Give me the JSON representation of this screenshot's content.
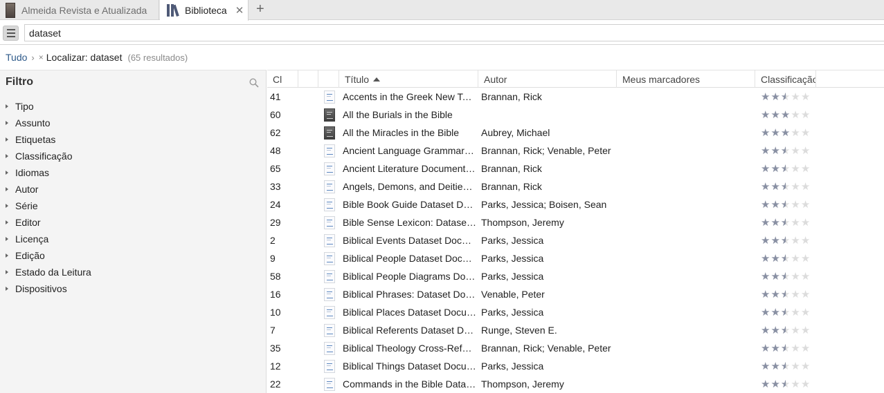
{
  "tabs": [
    {
      "label": "Almeida Revista e Atualizada",
      "active": false
    },
    {
      "label": "Biblioteca",
      "active": true
    }
  ],
  "search": {
    "value": "dataset"
  },
  "breadcrumb": {
    "root": "Tudo",
    "separator": "›",
    "remove": "×",
    "query": "Localizar: dataset",
    "count": "(65 resultados)"
  },
  "filter": {
    "title": "Filtro",
    "items": [
      "Tipo",
      "Assunto",
      "Etiquetas",
      "Classificação",
      "Idiomas",
      "Autor",
      "Série",
      "Editor",
      "Licença",
      "Edição",
      "Estado da Leitura",
      "Dispositivos"
    ]
  },
  "columns": {
    "num": "Cl",
    "title": "Título",
    "author": "Autor",
    "tags": "Meus marcadores",
    "rating": "Classificação"
  },
  "colors": {
    "accent_link": "#2e5a8a",
    "star_filled": "#8990a3",
    "star_empty": "#dcdcdc"
  },
  "rows": [
    {
      "num": "41",
      "title": "Accents in the Greek New Testament",
      "author": "Brannan, Rick",
      "icon": "document-icon",
      "rating": 2.5
    },
    {
      "num": "60",
      "title": "All the Burials in the Bible",
      "author": "",
      "icon": "dark-book-icon",
      "rating": 3
    },
    {
      "num": "62",
      "title": "All the Miracles in the Bible",
      "author": "Aubrey, Michael",
      "icon": "dark-book-icon",
      "rating": 3
    },
    {
      "num": "48",
      "title": "Ancient Language Grammar Cross-Reference",
      "author": "Brannan, Rick; Venable, Peter",
      "icon": "document-icon",
      "rating": 2.5
    },
    {
      "num": "65",
      "title": "Ancient Literature Documentation",
      "author": "Brannan, Rick",
      "icon": "document-icon",
      "rating": 2.5
    },
    {
      "num": "33",
      "title": "Angels, Demons, and Deities Dataset",
      "author": "Brannan, Rick",
      "icon": "document-icon",
      "rating": 2.5
    },
    {
      "num": "24",
      "title": "Bible Book Guide Dataset Documentation",
      "author": "Parks, Jessica; Boisen, Sean",
      "icon": "document-icon",
      "rating": 2.5
    },
    {
      "num": "29",
      "title": "Bible Sense Lexicon: Dataset Documentation",
      "author": "Thompson, Jeremy",
      "icon": "document-icon",
      "rating": 2.5
    },
    {
      "num": "2",
      "title": "Biblical Events Dataset Documentation",
      "author": "Parks, Jessica",
      "icon": "document-icon",
      "rating": 2.5
    },
    {
      "num": "9",
      "title": "Biblical People Dataset Documentation",
      "author": "Parks, Jessica",
      "icon": "document-icon",
      "rating": 2.5
    },
    {
      "num": "58",
      "title": "Biblical People Diagrams Documentation",
      "author": "Parks, Jessica",
      "icon": "document-icon",
      "rating": 2.5
    },
    {
      "num": "16",
      "title": "Biblical Phrases: Dataset Documentation",
      "author": "Venable, Peter",
      "icon": "document-icon",
      "rating": 2.5
    },
    {
      "num": "10",
      "title": "Biblical Places Dataset Documentation",
      "author": "Parks, Jessica",
      "icon": "document-icon",
      "rating": 2.5
    },
    {
      "num": "7",
      "title": "Biblical Referents Dataset Documentation",
      "author": "Runge, Steven E.",
      "icon": "document-icon",
      "rating": 2.5
    },
    {
      "num": "35",
      "title": "Biblical Theology Cross-Reference",
      "author": "Brannan, Rick; Venable, Peter",
      "icon": "document-icon",
      "rating": 2.5
    },
    {
      "num": "12",
      "title": "Biblical Things Dataset Documentation",
      "author": "Parks, Jessica",
      "icon": "document-icon",
      "rating": 2.5
    },
    {
      "num": "22",
      "title": "Commands in the Bible Dataset",
      "author": "Thompson, Jeremy",
      "icon": "document-icon",
      "rating": 2.5
    }
  ]
}
